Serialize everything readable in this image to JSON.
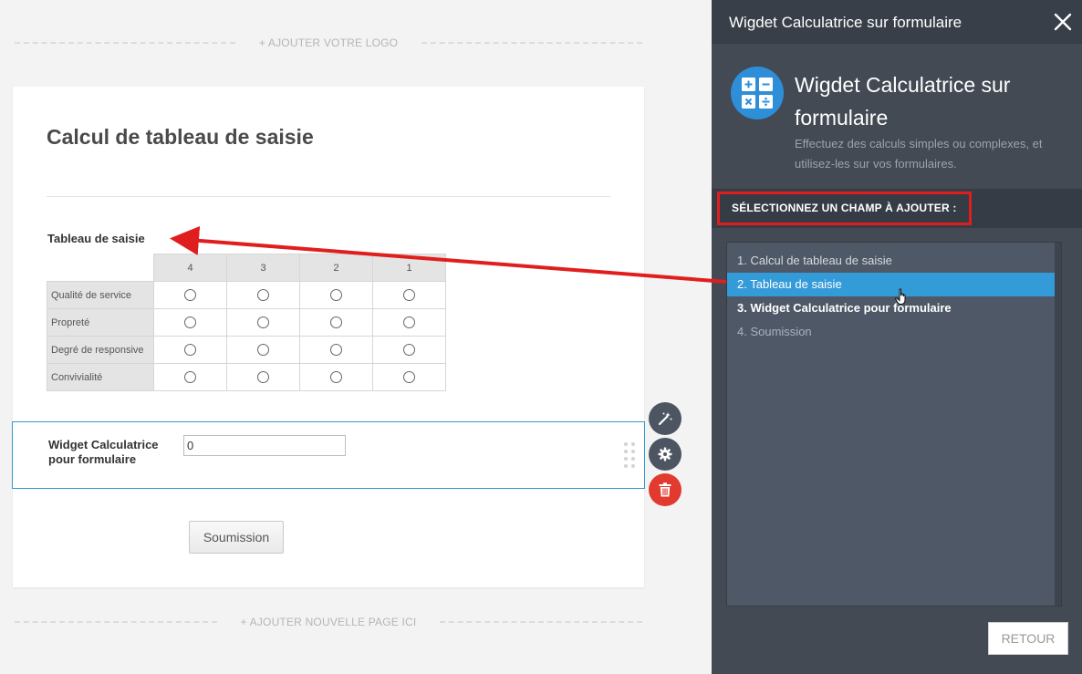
{
  "canvas": {
    "add_logo": "+ AJOUTER VOTRE LOGO",
    "add_page": "+ AJOUTER NOUVELLE PAGE ICI"
  },
  "form": {
    "title": "Calcul de tableau de saisie",
    "matrix": {
      "label": "Tableau de saisie",
      "columns": [
        "4",
        "3",
        "2",
        "1"
      ],
      "rows": [
        "Qualité de service",
        "Propreté",
        "Degré de responsive",
        "Convivialité"
      ]
    },
    "calculator": {
      "label": "Widget Calculatrice pour formulaire",
      "value": "0"
    },
    "submit_label": "Soumission"
  },
  "tools": {
    "wand": "wand-icon",
    "settings": "gear-icon",
    "delete": "trash-icon"
  },
  "panel": {
    "header_title": "Wigdet Calculatrice sur formulaire",
    "widget_title": "Wigdet Calculatrice sur formulaire",
    "widget_description": "Effectuez des calculs simples ou complexes, et utilisez-les sur vos formulaires.",
    "select_heading": "SÉLECTIONNEZ UN CHAMP À AJOUTER :",
    "fields": [
      {
        "label": "1. Calcul de tableau de saisie",
        "state": "normal"
      },
      {
        "label": "2. Tableau de saisie",
        "state": "selected"
      },
      {
        "label": "3. Widget Calculatrice pour formulaire",
        "state": "bold"
      },
      {
        "label": "4. Soumission",
        "state": "muted"
      }
    ],
    "back_label": "RETOUR"
  },
  "colors": {
    "panel_bg": "#434a54",
    "panel_header_bg": "#383f48",
    "selected_item": "#349bd9",
    "highlight_border": "#e01e1e",
    "active_field_border": "#2e99cf",
    "delete_button": "#e33a2f",
    "annotation_arrow": "#e01e1e"
  }
}
